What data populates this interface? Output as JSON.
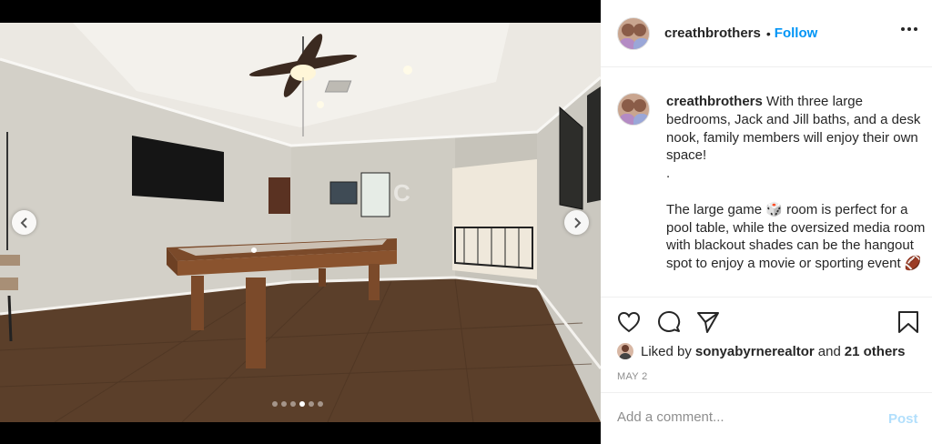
{
  "post": {
    "username": "creathbrothers",
    "separator": "•",
    "follow_label": "Follow",
    "caption": {
      "username": "creathbrothers",
      "line1": " With three large bedrooms, Jack and Jill baths, and a desk nook, family members will enjoy their own space!",
      "line2": ".",
      "line3": "The large game 🎲 room is perfect for a pool table, while the oversized media room with blackout shades can be the hangout spot to enjoy a movie or sporting event 🏈"
    },
    "likes": {
      "prefix": "Liked by",
      "user": "sonyabyrnerealtor",
      "conjunction": "and",
      "others": "21 others"
    },
    "date": "MAY 2",
    "comment_placeholder": "Add a comment...",
    "post_label": "Post"
  },
  "carousel": {
    "slide_count": 6,
    "active_index": 3
  },
  "colors": {
    "accent": "#0095f6",
    "post_disabled": "#b2dffc",
    "muted": "#8e8e8e",
    "text": "#262626"
  }
}
